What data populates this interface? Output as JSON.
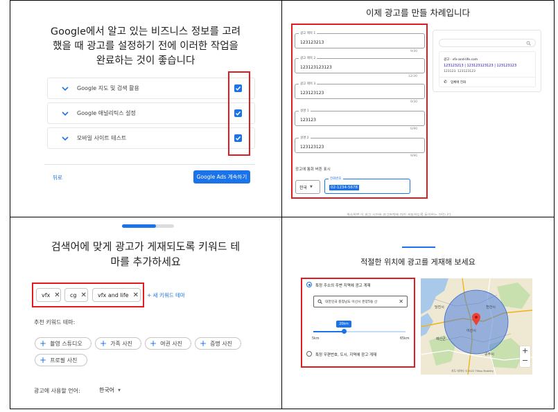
{
  "panel1": {
    "title_line1": "Google에서 알고 있는 비즈니스 정보를 고려",
    "title_line2": "했을 때 광고를 설정하기 전에 이러한 작업을",
    "title_line3": "완료하는 것이 좋습니다",
    "rows": [
      {
        "label": "Google 지도 및 검색 활용",
        "checked": true
      },
      {
        "label": "Google 애널리틱스 설정",
        "checked": true
      },
      {
        "label": "모바일 사이트 테스트",
        "checked": true
      }
    ],
    "back_label": "뒤로",
    "continue_label": "Google Ads 계속하기"
  },
  "panel2": {
    "title": "이제 광고를 만들 차례입니다",
    "fields": [
      {
        "label": "광고 제목 1",
        "value": "123123213",
        "counter": "9/30"
      },
      {
        "label": "광고 제목 2",
        "value": "123123123123",
        "counter": "12/30"
      },
      {
        "label": "광고 제목 3",
        "value": "123123123",
        "counter": "9/30"
      },
      {
        "label": "설명 1",
        "value": "123123",
        "counter": "6/90"
      },
      {
        "label": "설명 2",
        "value": "123123123",
        "counter": "9/90"
      }
    ],
    "call_button_label": "광고에 통화 버튼 표시",
    "country_value": "한국",
    "phone_label": "전화번호",
    "phone_value": "02-1234-5678",
    "preview": {
      "ad_line": "광고 · vfx-and-life.com",
      "headline": "123123213 | 123123123123 | 123123123",
      "desc": "123123. 123123123",
      "call": "업체에 전화"
    },
    "footer_text": "계속하면 이 광고 시안을 광고정책에 따라 검토하도록 동의하는 것입니다"
  },
  "panel3": {
    "title_line1": "검색어에 맞게 광고가 게재되도록 키워드 테",
    "title_line2": "마를 추가하세요",
    "chips": [
      "vfx",
      "cg",
      "vfx and life"
    ],
    "new_theme": "+ 새 키워드 테마",
    "suggest_label": "추천 키워드 테마:",
    "suggestions": [
      "촬영 스튜디오",
      "가족 사진",
      "여권 사진",
      "증명 사진",
      "프로필 사진"
    ],
    "lang_label": "광고에 사용할 언어:",
    "lang_value": "한국어"
  },
  "panel4": {
    "title": "적절한 위치에 광고를 게재해 보세요",
    "option1": "특정 주소의 주변 지역에 광고 게재",
    "address": "대한민국 충청남도 아산시 온양5동 산",
    "radius_value": "20km",
    "radius_fraction": 0.33,
    "min_label": "5km",
    "max_label": "65km",
    "option2": "특정 우편번호, 도시, 지역에 광고 게재",
    "map_labels": [
      "당진시",
      "천안시",
      "아산시",
      "공주시",
      "예산군"
    ],
    "map_footer": "지도 데이터 ©2022 TMap Mobility"
  },
  "colors": {
    "accent": "#1a73e8",
    "highlight": "#e11b22"
  }
}
